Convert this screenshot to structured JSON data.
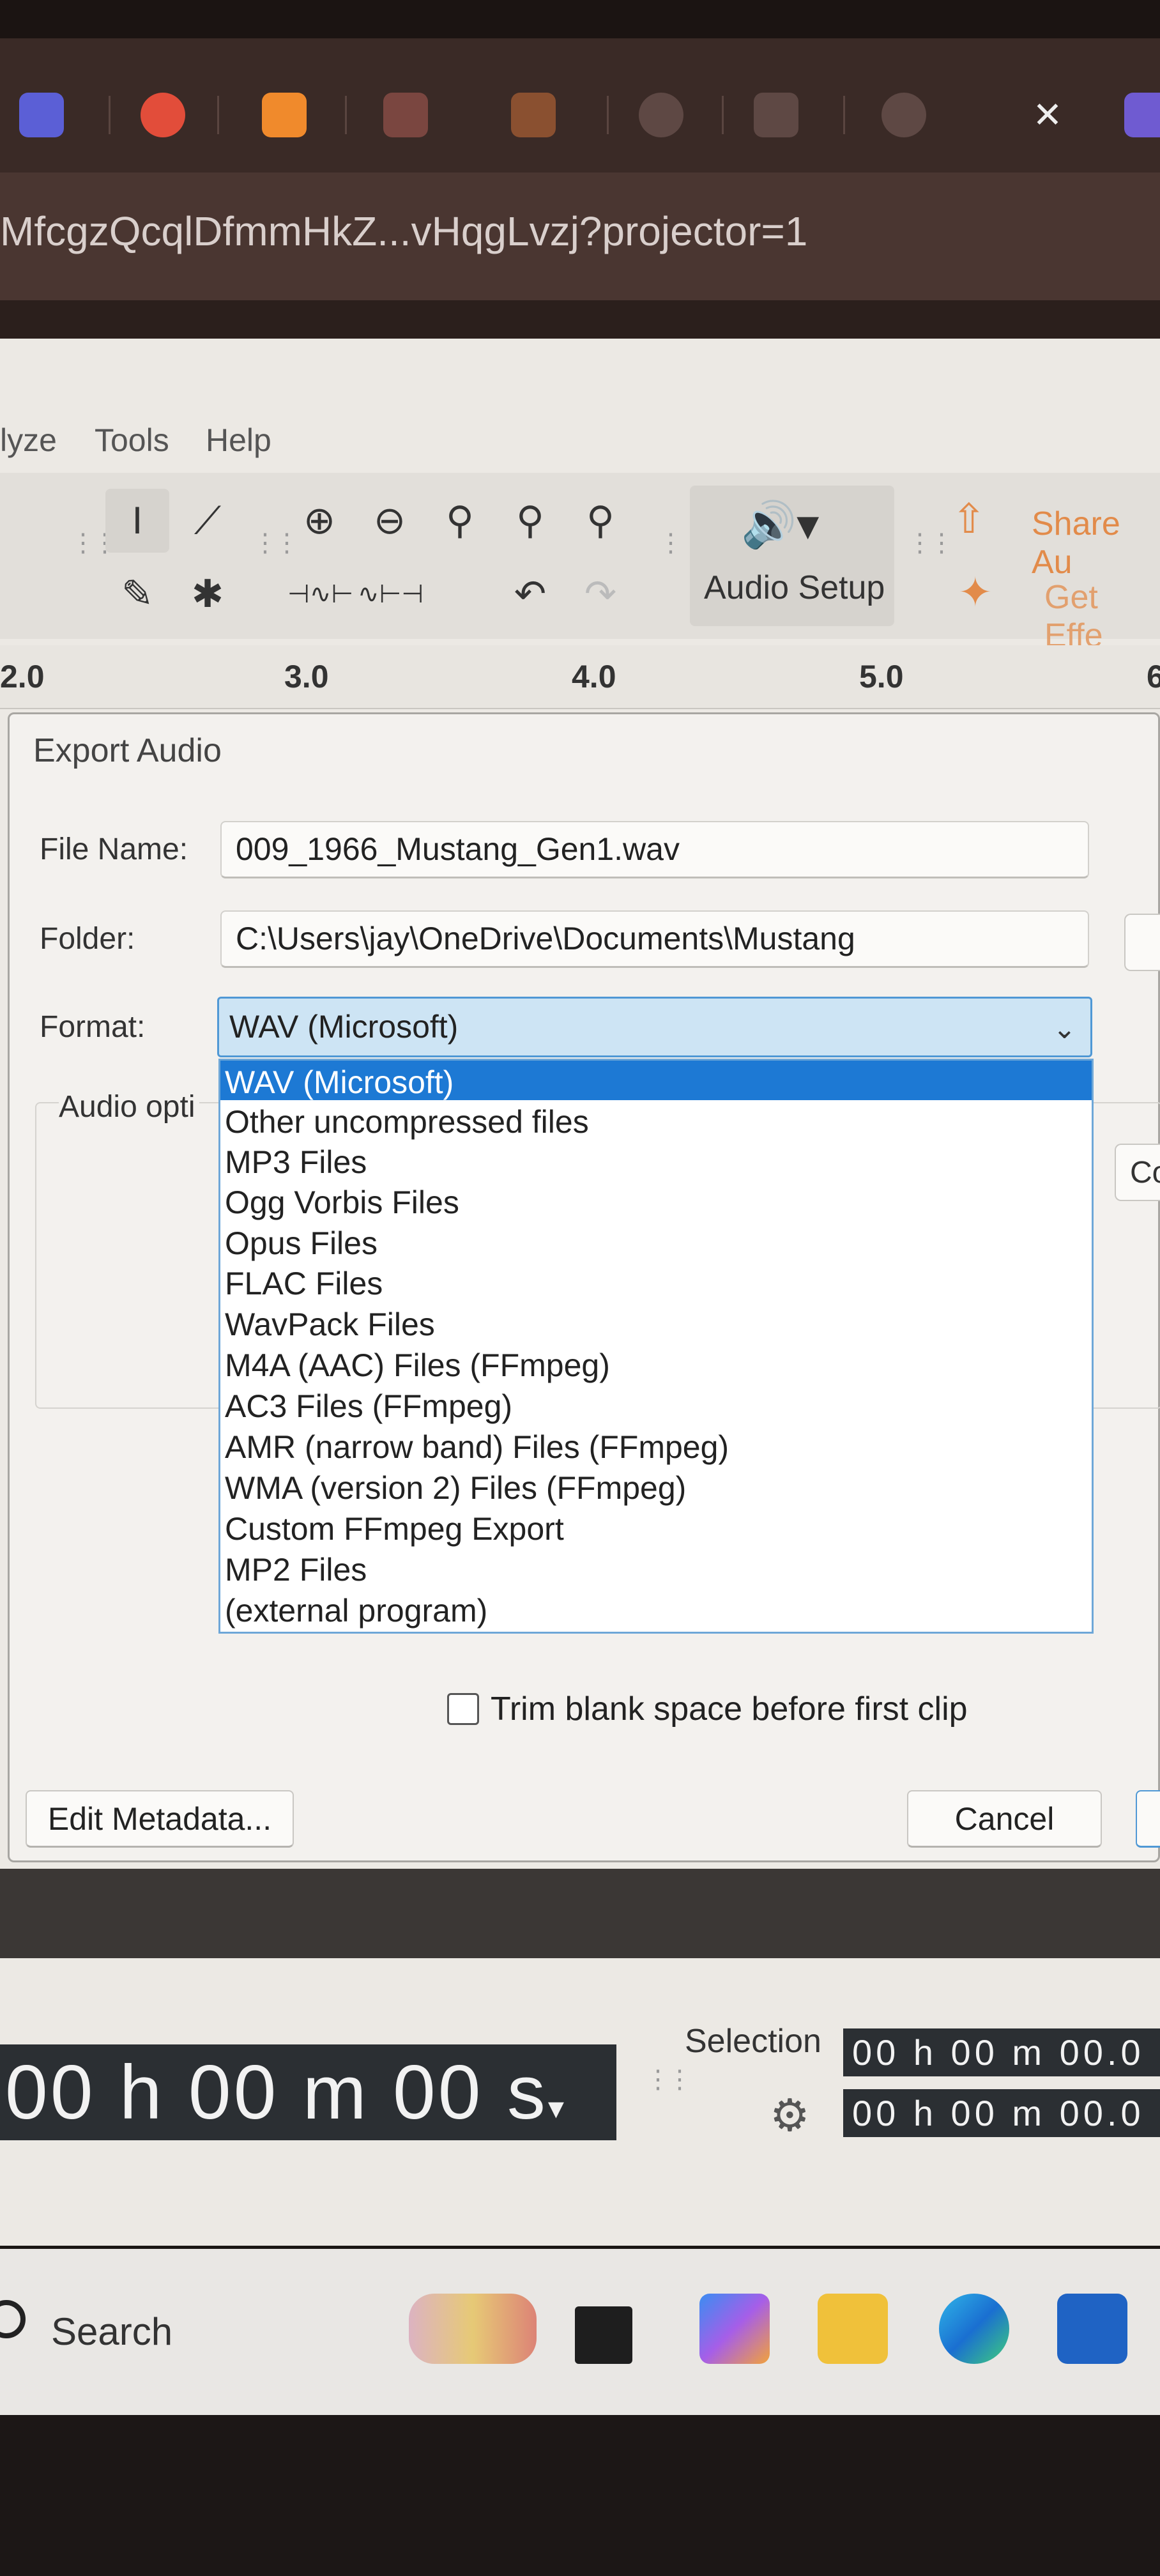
{
  "browser": {
    "url": "MfcgzQcqlDfmmHkZ...vHqgLvzj?projector=1",
    "close_glyph": "✕"
  },
  "app": {
    "menu": [
      "lyze",
      "Tools",
      "Help"
    ],
    "toolbar": {
      "audio_setup_label": "Audio Setup",
      "share_audio_label": "Share Au",
      "get_effects_label": "Get Effe"
    },
    "ruler_labels": [
      "2.0",
      "3.0",
      "4.0",
      "5.0",
      "6"
    ]
  },
  "dialog": {
    "title": "Export Audio",
    "file_name_label": "File Name:",
    "file_name_value": "009_1966_Mustang_Gen1.wav",
    "folder_label": "Folder:",
    "folder_value": "C:\\Users\\jay\\OneDrive\\Documents\\Mustang",
    "format_label": "Format:",
    "format_value": "WAV (Microsoft)",
    "audio_options_label": "Audio opti",
    "configure_stub": "Co",
    "format_options": [
      "WAV (Microsoft)",
      "Other uncompressed files",
      "MP3 Files",
      "Ogg Vorbis Files",
      "Opus Files",
      "FLAC Files",
      "WavPack Files",
      "M4A (AAC) Files (FFmpeg)",
      "AC3 Files (FFmpeg)",
      "AMR (narrow band) Files (FFmpeg)",
      "WMA (version 2) Files (FFmpeg)",
      "Custom FFmpeg Export",
      "MP2 Files",
      "(external program)"
    ],
    "trim_label": "Trim blank space before first clip",
    "edit_metadata_label": "Edit Metadata...",
    "cancel_label": "Cancel"
  },
  "status": {
    "time": "00 h 00 m 00 s",
    "selection_label": "Selection",
    "selection_start": "00 h 00 m 00.0",
    "selection_end": "00 h 00 m 00.0"
  },
  "taskbar": {
    "search_label": "Search"
  },
  "colors": {
    "accent_blue": "#1d79d4",
    "orange": "#e28b4a"
  }
}
